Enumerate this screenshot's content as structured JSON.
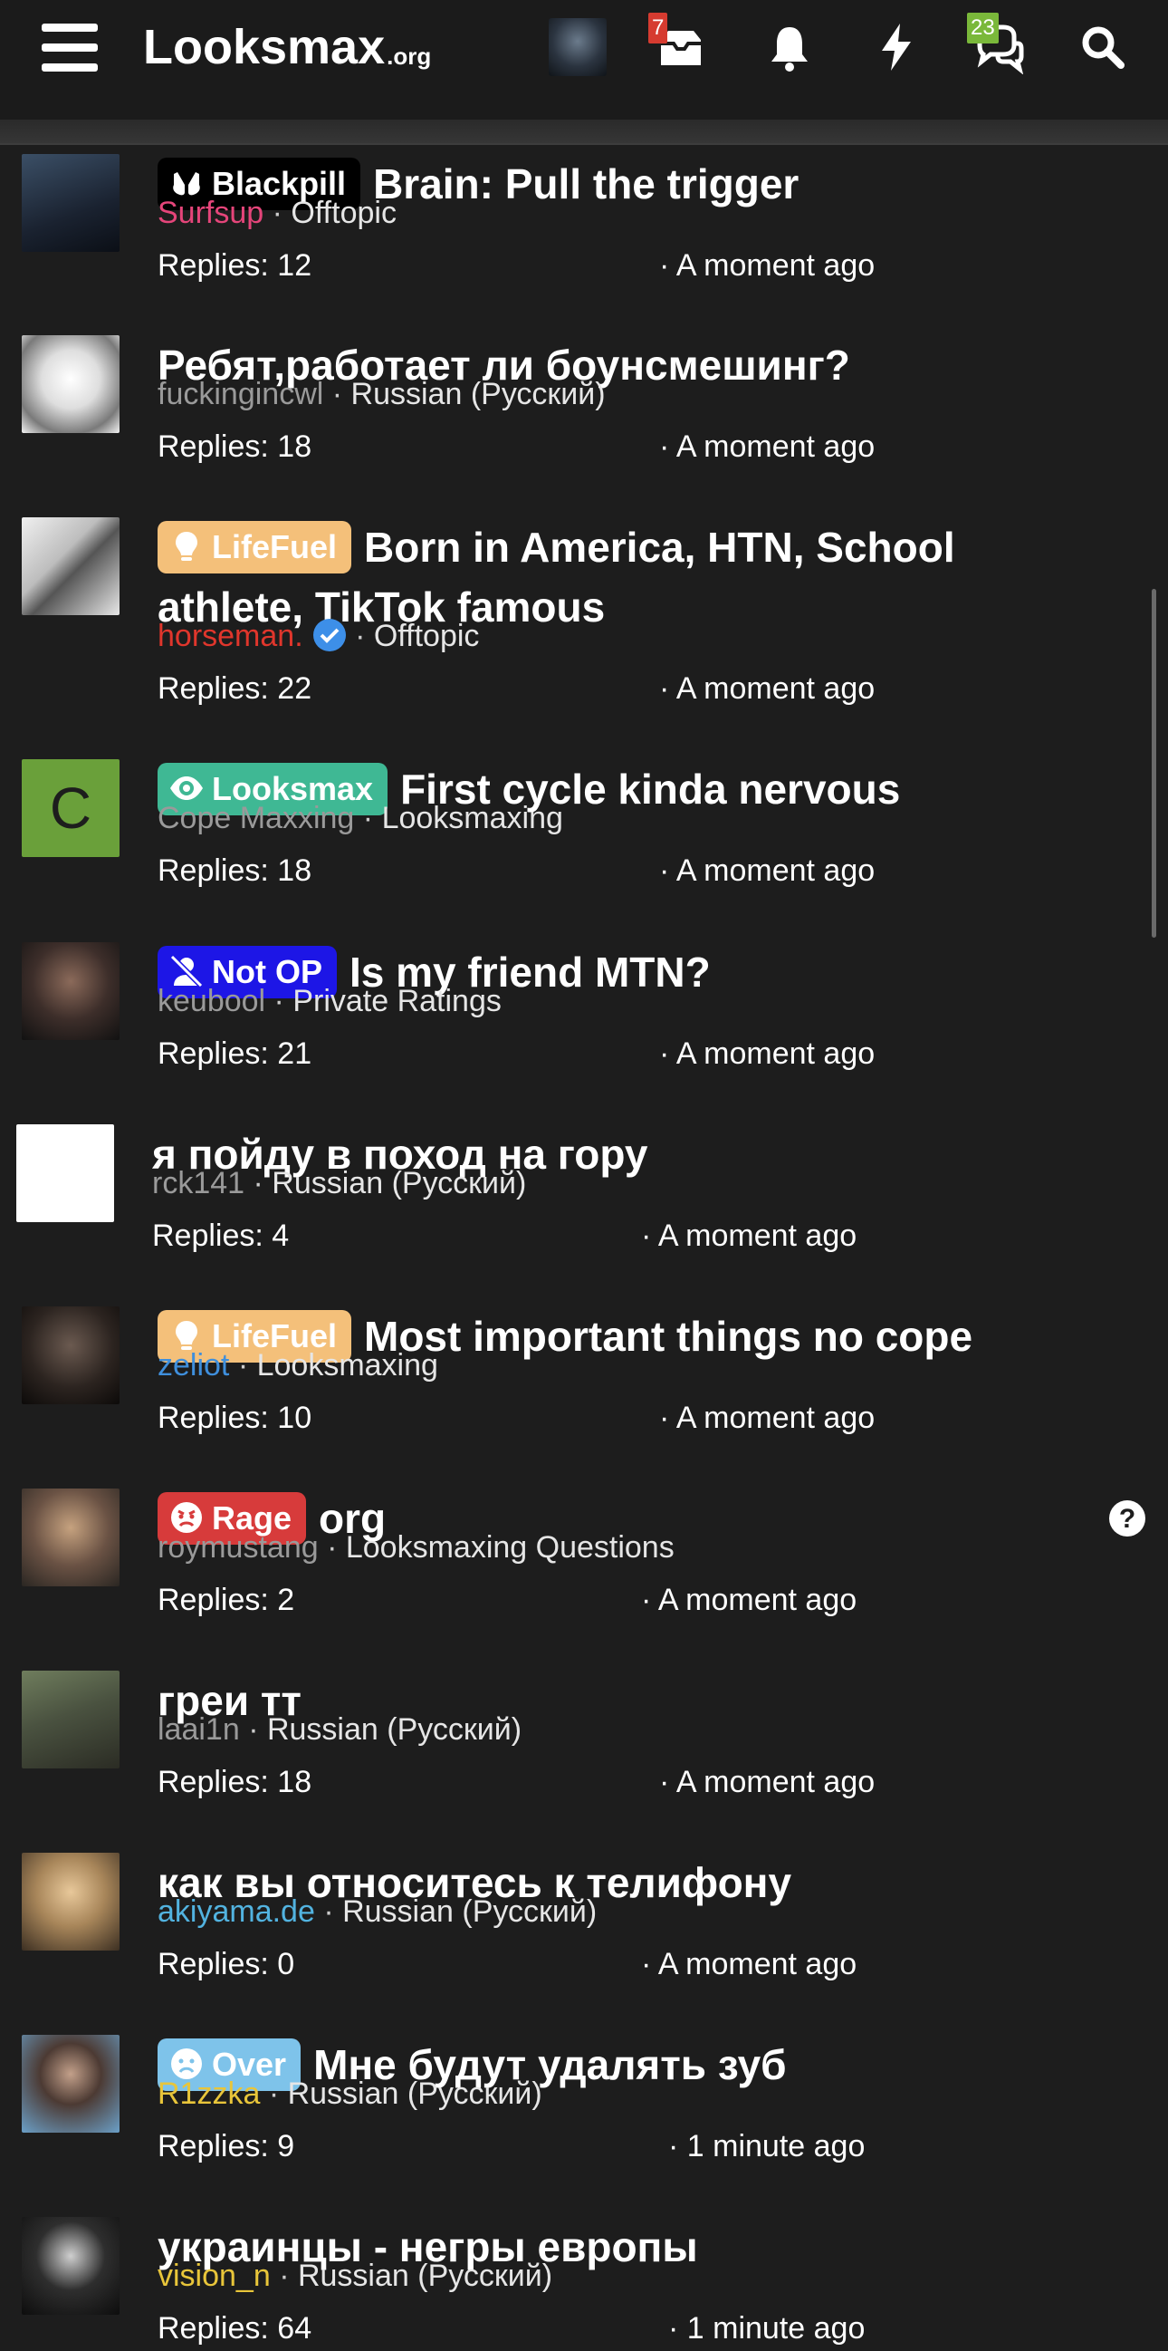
{
  "header": {
    "logo_main": "Looksmax",
    "logo_sub": ".org",
    "icons": [
      "menu-icon",
      "profile-avatar",
      "inbox-icon",
      "bell-icon",
      "bolt-icon",
      "chat-icon",
      "search-icon"
    ],
    "inbox_count": "7",
    "chat_count": "23"
  },
  "threads": [
    {
      "prefix": "Blackpill",
      "title": "Brain: Pull the trigger",
      "author": "Surfsup",
      "author_color": "#e5457a",
      "forum": "Offtopic",
      "replies": "Replies: 12",
      "time": "· A moment ago"
    },
    {
      "prefix": "",
      "title": "Ребят,работает ли боунсмешинг?",
      "author": "fuckingincwl",
      "author_color": "#9a9a9a",
      "forum": "Russian (Русский)",
      "replies": "Replies: 18",
      "time": "· A moment ago"
    },
    {
      "prefix": "LifeFuel",
      "title": "Born in America, HTN, School athlete, TikTok famous",
      "author": "horseman.",
      "author_color": "#e0362c",
      "forum": "Offtopic",
      "replies": "Replies: 22",
      "time": "· A moment ago"
    },
    {
      "prefix": "Looksmax",
      "title": "First cycle kinda nervous",
      "author": "Cope Maxxing",
      "author_color": "#9a9a9a",
      "forum": "Looksmaxing",
      "replies": "Replies: 18",
      "time": "· A moment ago"
    },
    {
      "prefix": "Not OP",
      "title": "Is my friend MTN?",
      "author": "keubool",
      "author_color": "#9a9a9a",
      "forum": "Private Ratings",
      "replies": "Replies: 21",
      "time": "· A moment ago"
    },
    {
      "prefix": "",
      "title": "я пойду в поход на гору",
      "author": "rck141",
      "author_color": "#9a9a9a",
      "forum": "Russian (Русский)",
      "replies": "Replies: 4",
      "time": "· A moment ago"
    },
    {
      "prefix": "LifeFuel",
      "title": "Most important things no cope",
      "author": "zeliot",
      "author_color": "#3f8fdc",
      "forum": "Looksmaxing",
      "replies": "Replies: 10",
      "time": "· A moment ago"
    },
    {
      "prefix": "Rage",
      "title": "org",
      "author": "roymustang",
      "author_color": "#9a9a9a",
      "forum": "Looksmaxing Questions",
      "replies": "Replies: 2",
      "time": "· A moment ago"
    },
    {
      "prefix": "",
      "title": "греи тт",
      "author": "laai1n",
      "author_color": "#9a9a9a",
      "forum": "Russian (Русский)",
      "replies": "Replies: 18",
      "time": "· A moment ago"
    },
    {
      "prefix": "",
      "title": "как вы относитесь к телифону",
      "author": "akiyama.de",
      "author_color": "#52b3e0",
      "forum": "Russian (Русский)",
      "replies": "Replies: 0",
      "time": "· A moment ago"
    },
    {
      "prefix": "Over",
      "title": "Мне будут удалять зуб",
      "author": "R1zzka",
      "author_color": "#e8c53a",
      "forum": "Russian (Русский)",
      "replies": "Replies: 9",
      "time": "· 1 minute ago"
    },
    {
      "prefix": "",
      "title": "украинцы - негры европы",
      "author": "vision_n",
      "author_color": "#e8c53a",
      "forum": "Russian (Русский)",
      "replies": "Replies: 64",
      "time": "· 1 minute ago"
    }
  ],
  "prefix_styles": {
    "Blackpill": {
      "bg": "#000000",
      "fg": "#ffffff",
      "icon": "glasses-icon"
    },
    "LifeFuel": {
      "bg": "#f4c07a",
      "fg": "#ffffff",
      "icon": "lightbulb-icon"
    },
    "Looksmax": {
      "bg": "#3fb894",
      "fg": "#ffffff",
      "icon": "eye-icon"
    },
    "Not OP": {
      "bg": "#1d16e6",
      "fg": "#ffffff",
      "icon": "user-slash-icon"
    },
    "Rage": {
      "bg": "#d73b3b",
      "fg": "#ffffff",
      "icon": "angry-face-icon"
    },
    "Over": {
      "bg": "#7ec3ea",
      "fg": "#ffffff",
      "icon": "sad-face-icon"
    }
  },
  "avatar_letter": "C",
  "colors": {
    "background": "#1d1d1d",
    "header": "#1b1b1b",
    "badge_red": "#d63b30",
    "badge_green": "#7ab83a",
    "verified_blue": "#3d8fe8"
  }
}
